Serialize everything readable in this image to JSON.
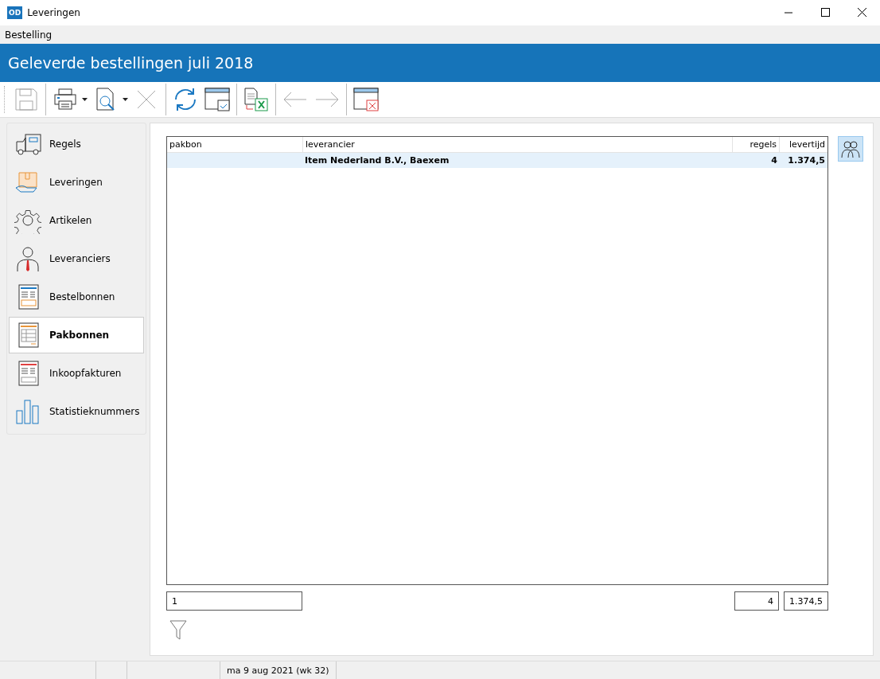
{
  "window": {
    "title": "Leveringen",
    "app_badge": "OD"
  },
  "menu": [
    "Bestelling"
  ],
  "header": {
    "title": "Geleverde bestellingen juli 2018"
  },
  "toolbar": [
    {
      "kind": "save",
      "disabled": true
    },
    {
      "kind": "separator"
    },
    {
      "kind": "print",
      "disabled": false,
      "dropdown": true
    },
    {
      "kind": "preview",
      "disabled": false,
      "dropdown": true
    },
    {
      "kind": "delete",
      "disabled": true
    },
    {
      "kind": "separator"
    },
    {
      "kind": "refresh",
      "disabled": false
    },
    {
      "kind": "window-check",
      "disabled": false
    },
    {
      "kind": "separator"
    },
    {
      "kind": "export",
      "disabled": false
    },
    {
      "kind": "separator"
    },
    {
      "kind": "back",
      "disabled": true
    },
    {
      "kind": "forward",
      "disabled": true
    },
    {
      "kind": "separator"
    },
    {
      "kind": "close-window",
      "disabled": false
    }
  ],
  "sidebar": {
    "items": [
      {
        "kind": "truck",
        "label": "Regels",
        "selected": false
      },
      {
        "kind": "package",
        "label": "Leveringen",
        "selected": false
      },
      {
        "kind": "gear",
        "label": "Artikelen",
        "selected": false
      },
      {
        "kind": "person",
        "label": "Leveranciers",
        "selected": false
      },
      {
        "kind": "order",
        "label": "Bestelbonnen",
        "selected": false
      },
      {
        "kind": "packing",
        "label": "Pakbonnen",
        "selected": true
      },
      {
        "kind": "invoice",
        "label": "Inkoopfakturen",
        "selected": false
      },
      {
        "kind": "chart",
        "label": "Statistieknummers",
        "selected": false
      }
    ]
  },
  "table": {
    "columns": [
      "pakbon",
      "leverancier",
      "regels",
      "levertijd"
    ],
    "rows": [
      {
        "leverancier": "Item Nederland B.V., Baexem",
        "regels": "4",
        "levertijd": "1.374,5",
        "selected": true
      }
    ]
  },
  "totals": {
    "pakbon": "1",
    "regels": "4",
    "levertijd": "1.374,5"
  },
  "status_bar": {
    "date": "ma 9 aug 2021 (wk 32)"
  }
}
